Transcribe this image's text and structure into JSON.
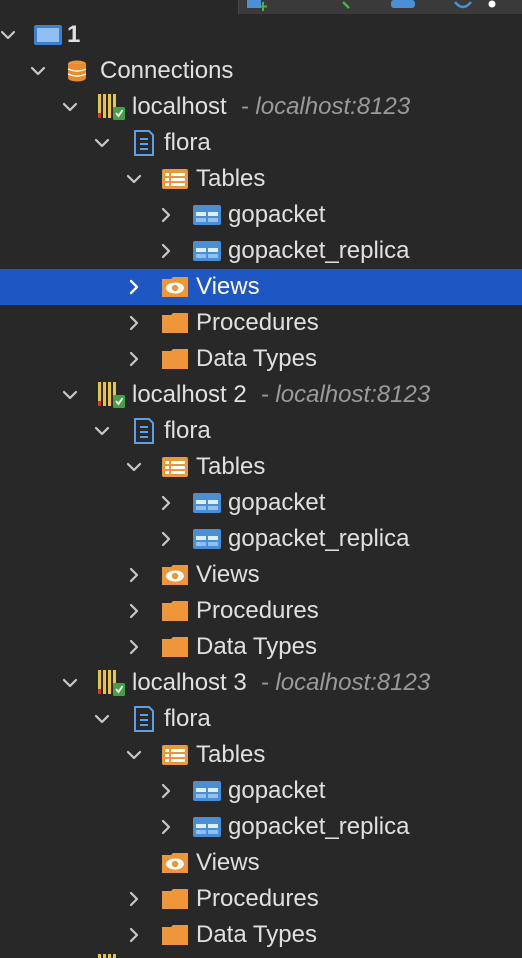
{
  "root": {
    "label": "1"
  },
  "connections": {
    "label": "Connections"
  },
  "hosts": [
    {
      "name": "localhost",
      "address": "- localhost:8123",
      "db": "flora",
      "tables_label": "Tables",
      "tables": [
        "gopacket",
        "gopacket_replica"
      ],
      "views": "Views",
      "procedures": "Procedures",
      "datatypes": "Data Types"
    },
    {
      "name": "localhost 2",
      "address": "- localhost:8123",
      "db": "flora",
      "tables_label": "Tables",
      "tables": [
        "gopacket",
        "gopacket_replica"
      ],
      "views": "Views",
      "procedures": "Procedures",
      "datatypes": "Data Types"
    },
    {
      "name": "localhost 3",
      "address": "- localhost:8123",
      "db": "flora",
      "tables_label": "Tables",
      "tables": [
        "gopacket",
        "gopacket_replica"
      ],
      "views": "Views",
      "procedures": "Procedures",
      "datatypes": "Data Types"
    }
  ],
  "selected_item": "Views (localhost)"
}
